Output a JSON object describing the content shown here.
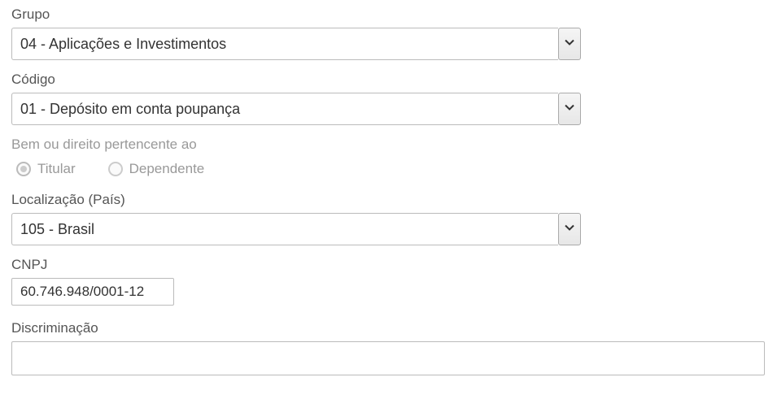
{
  "grupo": {
    "label": "Grupo",
    "value": "04 - Aplicações e Investimentos"
  },
  "codigo": {
    "label": "Código",
    "value": "01 - Depósito em conta poupança"
  },
  "bem_direito": {
    "label": "Bem ou direito pertencente ao",
    "titular_label": "Titular",
    "dependente_label": "Dependente"
  },
  "localizacao": {
    "label": "Localização (País)",
    "value": "105 - Brasil"
  },
  "cnpj": {
    "label": "CNPJ",
    "value": "60.746.948/0001-12"
  },
  "discriminacao": {
    "label": "Discriminação",
    "value": ""
  }
}
